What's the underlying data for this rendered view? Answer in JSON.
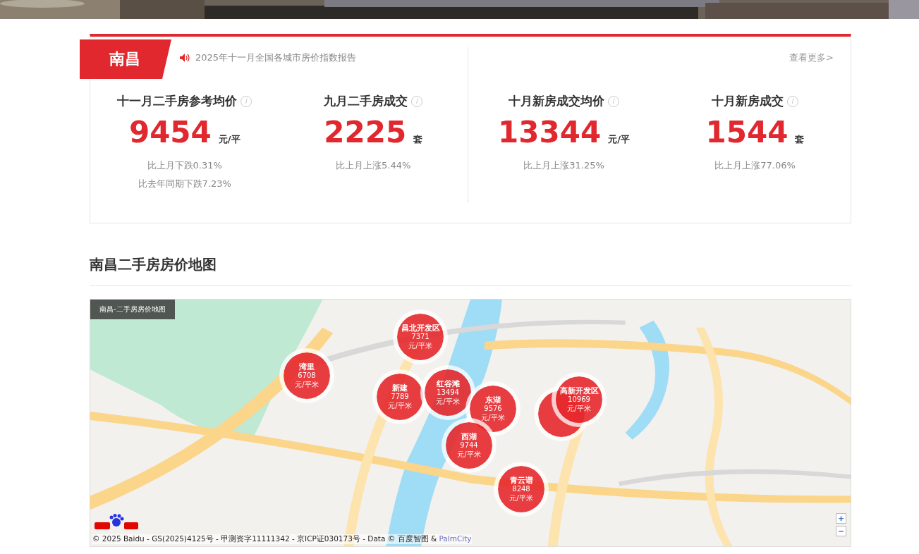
{
  "summary": {
    "city": "南昌",
    "notice": "2025年十一月全国各城市房价指数报告",
    "more_link": "查看更多>",
    "stats": [
      {
        "title": "十一月二手房参考均价",
        "info": "i",
        "value": "9454",
        "unit": "元/平",
        "changes": [
          "比上月下跌0.31%",
          "比去年同期下跌7.23%"
        ]
      },
      {
        "title": "九月二手房成交",
        "info": "i",
        "value": "2225",
        "unit": "套",
        "changes": [
          "比上月上涨5.44%"
        ]
      },
      {
        "title": "十月新房成交均价",
        "info": "i",
        "value": "13344",
        "unit": "元/平",
        "changes": [
          "比上月上涨31.25%"
        ]
      },
      {
        "title": "十月新房成交",
        "info": "i",
        "value": "1544",
        "unit": "套",
        "changes": [
          "比上月上涨77.06%"
        ]
      }
    ]
  },
  "map_section": {
    "title": "南昌二手房房价地图",
    "map_label": "南昌-二手房房价地图",
    "markers": [
      {
        "kind": "label",
        "name": "昌北开发区",
        "price": "7371",
        "unit": "元/平米"
      },
      {
        "kind": "label",
        "name": "湾里",
        "price": "6708",
        "unit": "元/平米"
      },
      {
        "kind": "label",
        "name": "新建",
        "price": "7789",
        "unit": "元/平米"
      },
      {
        "kind": "label",
        "name": "红谷滩",
        "price": "13494",
        "unit": "元/平米"
      },
      {
        "kind": "covered"
      },
      {
        "kind": "label",
        "name": "高新开发区",
        "price": "10969",
        "unit": "元/平米"
      },
      {
        "kind": "label",
        "name": "东湖",
        "price": "9576",
        "unit": "元/平米"
      },
      {
        "kind": "label",
        "name": "西湖",
        "price": "9744",
        "unit": "元/平米"
      },
      {
        "kind": "label",
        "name": "青云谱",
        "price": "8248",
        "unit": "元/平米"
      }
    ],
    "copyright": "© 2025 Baidu - GS(2025)4125号 - 甲测资字11111342 - 京ICP证030173号 - Data © 百度智图 &",
    "copyright_link": "PalmCity",
    "zoom_in": "+",
    "zoom_out": "−"
  }
}
